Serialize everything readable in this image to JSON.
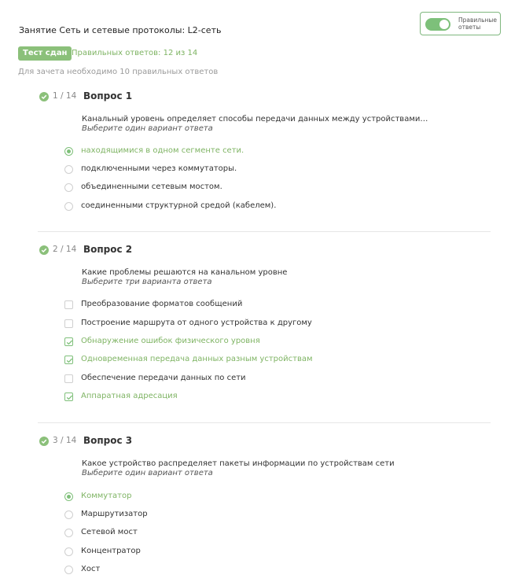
{
  "header": {
    "lesson_title": "Занятие Сеть и сетевые протоколы: L2-сеть",
    "toggle_label": "Правильные ответы",
    "toggle_on": true
  },
  "result": {
    "badge": "Тест сдан",
    "score": "Правильных ответов: 12 из 14",
    "pass_note": "Для зачета необходимо 10 правильных ответов"
  },
  "colors": {
    "accent": "#8bc07a",
    "correct_text": "#7fb464",
    "muted": "#9a9a9a"
  },
  "questions": [
    {
      "num": "1 / 14",
      "title": "Вопрос 1",
      "text": "Канальный уровень определяет способы передачи данных между устройствами…",
      "hint": "Выберите один вариант ответа",
      "type": "radio",
      "options": [
        {
          "label": "находящимися в одном сегменте сети.",
          "selected": true
        },
        {
          "label": "подключенными через коммутаторы.",
          "selected": false
        },
        {
          "label": "объединенными сетевым мостом.",
          "selected": false
        },
        {
          "label": "соединенными структурной средой (кабелем).",
          "selected": false
        }
      ]
    },
    {
      "num": "2 / 14",
      "title": "Вопрос 2",
      "text": "Какие проблемы решаются на канальном уровне",
      "hint": "Выберите три варианта ответа",
      "type": "checkbox",
      "options": [
        {
          "label": "Преобразование форматов сообщений",
          "selected": false
        },
        {
          "label": "Построение маршрута от одного устройства к другому",
          "selected": false
        },
        {
          "label": "Обнаружение ошибок физического уровня",
          "selected": true
        },
        {
          "label": "Одновременная передача данных разным устройствам",
          "selected": true
        },
        {
          "label": "Обеспечение передачи данных по сети",
          "selected": false
        },
        {
          "label": "Аппаратная адресация",
          "selected": true
        }
      ]
    },
    {
      "num": "3 / 14",
      "title": "Вопрос 3",
      "text": "Какое устройство распределяет пакеты информации по устройствам сети",
      "hint": "Выберите один вариант ответа",
      "type": "radio",
      "options": [
        {
          "label": "Коммутатор",
          "selected": true
        },
        {
          "label": "Маршрутизатор",
          "selected": false
        },
        {
          "label": "Сетевой мост",
          "selected": false
        },
        {
          "label": "Концентратор",
          "selected": false
        },
        {
          "label": "Хост",
          "selected": false
        }
      ]
    }
  ]
}
